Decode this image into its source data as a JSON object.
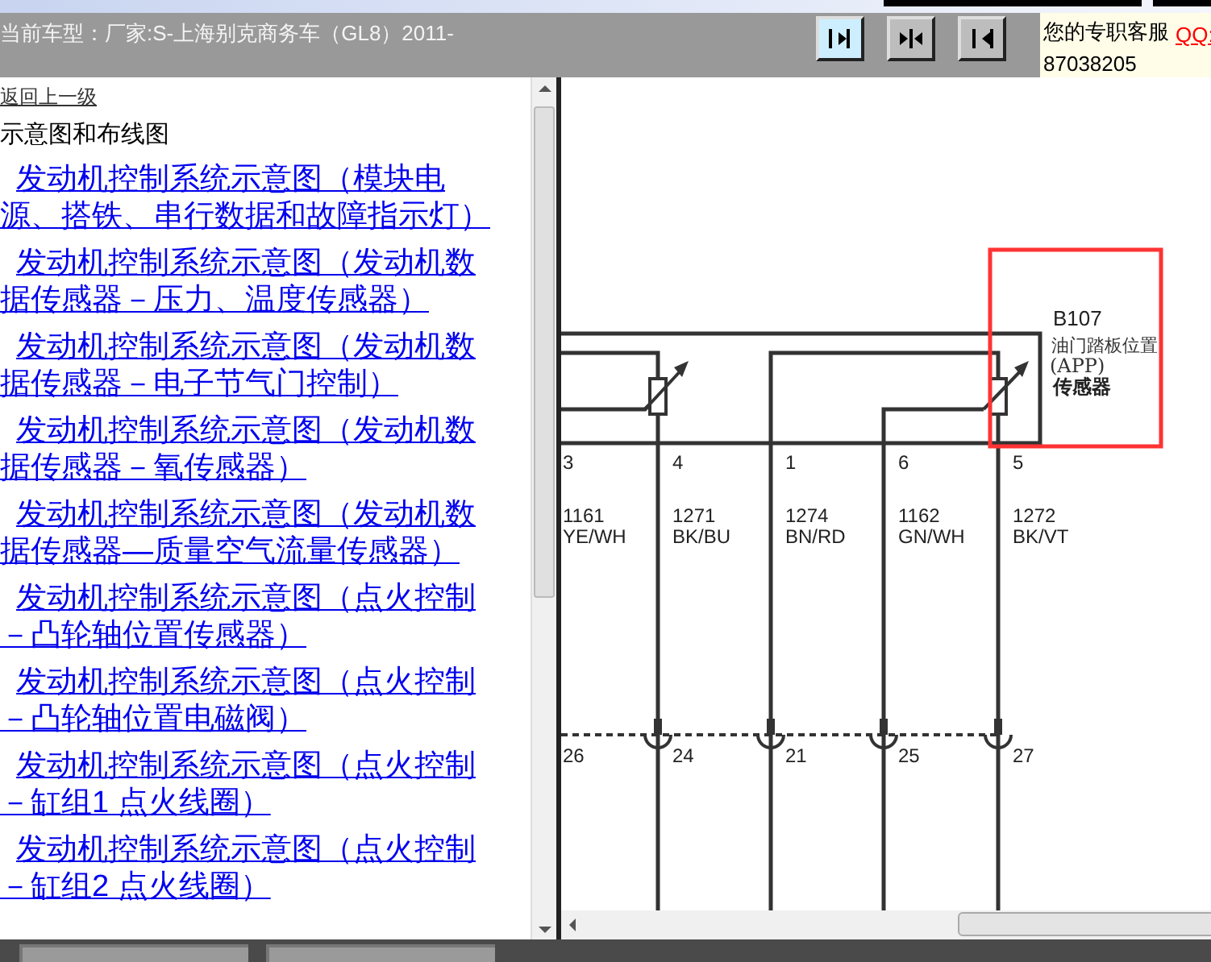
{
  "header": {
    "vehicle_label": "当前车型：",
    "vehicle": "厂家:S-上海别克商务车（GL8）2011-",
    "nav_buttons": [
      {
        "kind": "right",
        "selected": true
      },
      {
        "kind": "split",
        "selected": false
      },
      {
        "kind": "left",
        "selected": false
      }
    ],
    "service": {
      "label": "您的专职客服",
      "qq_link": "QQ:",
      "phone": "87038205"
    }
  },
  "sidebar": {
    "back_link": "返回上一级",
    "section_title": "示意图和布线图",
    "links": [
      {
        "lines": [
          "发动机控制系统示意图（模块电",
          "源、搭铁、串行数据和故障指示灯）"
        ]
      },
      {
        "lines": [
          "发动机控制系统示意图（发动机数",
          "据传感器－压力、温度传感器）"
        ]
      },
      {
        "lines": [
          "发动机控制系统示意图（发动机数",
          "据传感器－电子节气门控制）"
        ]
      },
      {
        "lines": [
          "发动机控制系统示意图（发动机数",
          "据传感器－氧传感器）"
        ]
      },
      {
        "lines": [
          "发动机控制系统示意图（发动机数",
          "据传感器—质量空气流量传感器）"
        ]
      },
      {
        "lines": [
          "发动机控制系统示意图（点火控制",
          "－凸轮轴位置传感器）"
        ]
      },
      {
        "lines": [
          "发动机控制系统示意图（点火控制",
          "－凸轮轴位置电磁阀）"
        ]
      },
      {
        "lines": [
          "发动机控制系统示意图（点火控制",
          "－缸组1 点火线圈）"
        ]
      },
      {
        "lines": [
          "发动机控制系统示意图（点火控制",
          "－缸组2 点火线圈）"
        ]
      }
    ]
  },
  "diagram": {
    "component": {
      "code": "B107",
      "name": "油门踏板位置",
      "abbr": "(APP)",
      "type": "传感器"
    },
    "pins": [
      {
        "pin": "3",
        "circuit": "1161",
        "wire_color": "YE/WH",
        "connector_pin": "26"
      },
      {
        "pin": "4",
        "circuit": "1271",
        "wire_color": "BK/BU",
        "connector_pin": "24"
      },
      {
        "pin": "1",
        "circuit": "1274",
        "wire_color": "BN/RD",
        "connector_pin": "21"
      },
      {
        "pin": "6",
        "circuit": "1162",
        "wire_color": "GN/WH",
        "connector_pin": "25"
      },
      {
        "pin": "5",
        "circuit": "1272",
        "wire_color": "BK/VT",
        "connector_pin": "27"
      }
    ]
  }
}
